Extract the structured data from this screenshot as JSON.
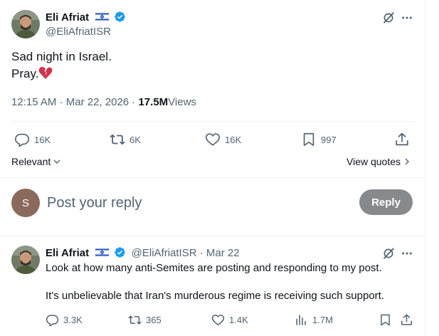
{
  "colors": {
    "verified": "#1d9bf0",
    "text_secondary": "#536471",
    "reply_button_bg": "#878a8c",
    "heart": "#d0334a"
  },
  "main_post": {
    "author_name": "Eli Afriat",
    "author_handle": "@EliAfriatISR",
    "flag_icon": "israel-flag-icon",
    "text_line1": "Sad night in Israel.",
    "text_line2": "Pray.",
    "emoji_icon": "broken-heart-icon",
    "time": "12:15 AM",
    "date": "Mar 22, 2026",
    "separator": "·",
    "views_count": "17.5M",
    "views_label": "Views",
    "actions": {
      "replies": "16K",
      "reposts": "6K",
      "likes": "16K",
      "bookmarks": "997"
    }
  },
  "sort": {
    "label": "Relevant",
    "view_quotes": "View quotes"
  },
  "composer": {
    "avatar_letter": "S",
    "placeholder": "Post your reply",
    "button_label": "Reply"
  },
  "reply_post": {
    "author_name": "Eli Afriat",
    "author_handle": "@EliAfriatISR",
    "dot": "·",
    "date": "Mar 22",
    "text_line1": "Look at how many anti-Semites are posting and responding to my post.",
    "text_line2": "It's unbelievable that Iran's murderous regime is receiving such support.",
    "actions": {
      "replies": "3.3K",
      "reposts": "365",
      "likes": "1.4K",
      "views": "1.7M"
    }
  }
}
